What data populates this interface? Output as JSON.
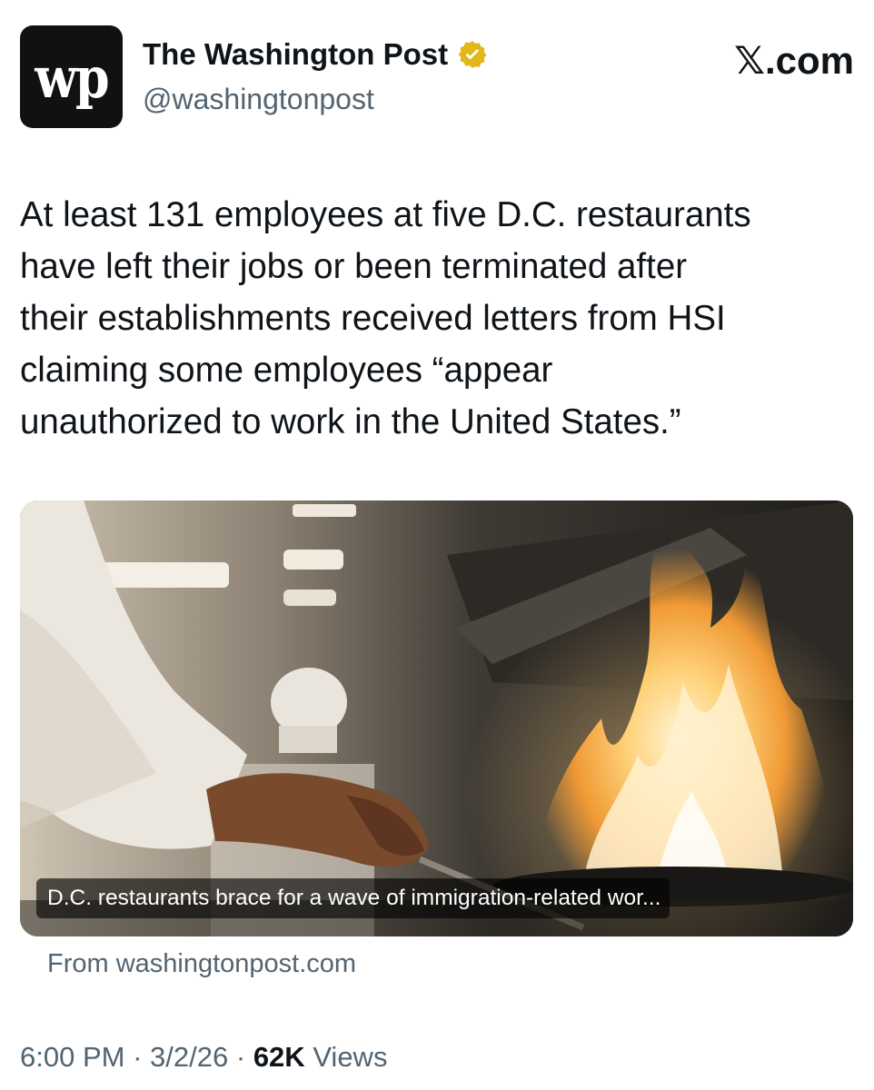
{
  "account": {
    "logo_text": "wp",
    "display_name": "The Washington Post",
    "handle": "@washingtonpost",
    "verified_icon": "gold-verified-badge-icon",
    "verified_color": "#e2b719"
  },
  "site_mark": "𝕏.com",
  "tweet": {
    "text": "At least 131 employees at five D.C. restaurants\nhave left their jobs or been terminated after\ntheir establishments received letters from HSI\nclaiming some employees “appear\nunauthorized to work in the United States.”"
  },
  "media": {
    "caption": "D.C. restaurants brace for a wave of immigration-related wor...",
    "source": "From washingtonpost.com"
  },
  "meta": {
    "time": "6:00 PM",
    "separator": "·",
    "date": "3/2/26",
    "views_count": "62K",
    "views_label": "Views"
  },
  "colors": {
    "text_primary": "#0f1419",
    "text_secondary": "#536471",
    "background": "#ffffff"
  }
}
